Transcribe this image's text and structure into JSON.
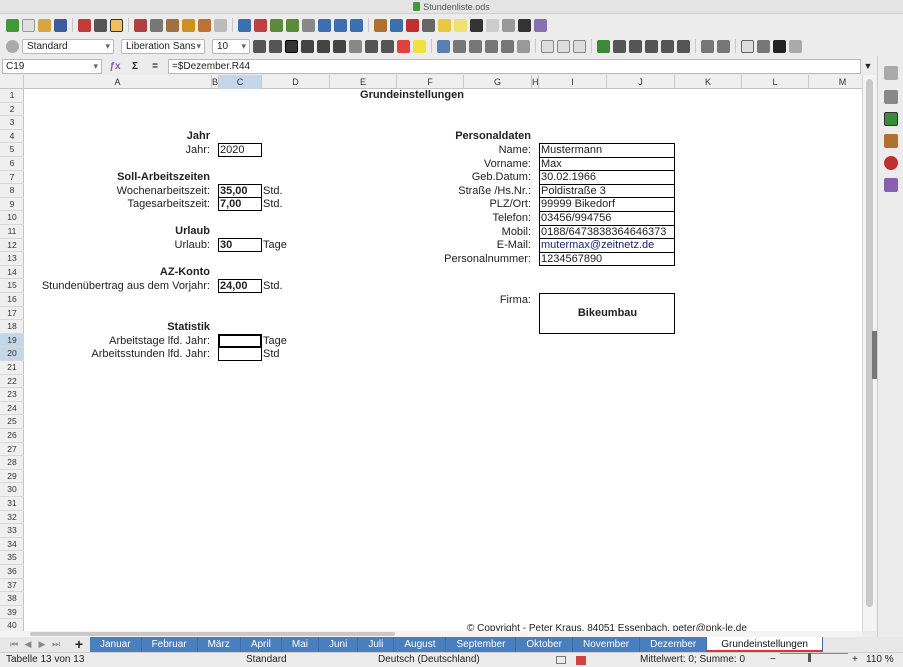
{
  "window": {
    "title": "Stundenliste.ods"
  },
  "toolbar": {
    "paragraph_style": "Standard",
    "font_name": "Liberation Sans",
    "font_size": "10"
  },
  "formula_bar": {
    "name_box": "C19",
    "formula": "=$Dezember.R44"
  },
  "columns": [
    "A",
    "B",
    "C",
    "D",
    "E",
    "F",
    "G",
    "H",
    "I",
    "J",
    "K",
    "L",
    "M"
  ],
  "rows": [
    "1",
    "2",
    "3",
    "4",
    "5",
    "6",
    "7",
    "8",
    "9",
    "10",
    "11",
    "12",
    "13",
    "14",
    "15",
    "16",
    "17",
    "18",
    "19",
    "20",
    "21",
    "22",
    "23",
    "24",
    "25",
    "26",
    "27",
    "28",
    "29",
    "30",
    "31",
    "32",
    "33",
    "34",
    "35",
    "36",
    "37",
    "38",
    "39",
    "40"
  ],
  "sheet": {
    "title": "Grundeinstellungen",
    "jahr": {
      "heading": "Jahr",
      "label": "Jahr:",
      "value": "2020"
    },
    "soll": {
      "heading": "Soll-Arbeitszeiten",
      "woche_label": "Wochenarbeitszeit:",
      "woche_value": "35,00",
      "woche_unit": "Std.",
      "tag_label": "Tagesarbeitszeit:",
      "tag_value": "7,00",
      "tag_unit": "Std."
    },
    "urlaub": {
      "heading": "Urlaub",
      "label": "Urlaub:",
      "value": "30",
      "unit": "Tage"
    },
    "az": {
      "heading": "AZ-Konto",
      "label": "Stundenübertrag aus dem Vorjahr:",
      "value": "24,00",
      "unit": "Std."
    },
    "statistik": {
      "heading": "Statistik",
      "tage_label": "Arbeitstage lfd. Jahr:",
      "tage_value": "",
      "tage_unit": "Tage",
      "stunden_label": "Arbeitsstunden lfd. Jahr:",
      "stunden_value": "",
      "stunden_unit": "Std"
    },
    "personal": {
      "heading": "Personaldaten",
      "fields": [
        {
          "label": "Name:",
          "value": "Mustermann"
        },
        {
          "label": "Vorname:",
          "value": "Max"
        },
        {
          "label": "Geb.Datum:",
          "value": "30.02.1966"
        },
        {
          "label": "Straße /Hs.Nr.:",
          "value": "Poldistraße 3"
        },
        {
          "label": "PLZ/Ort:",
          "value": "99999 Bikedorf"
        },
        {
          "label": "Telefon:",
          "value": "03456/994756"
        },
        {
          "label": "Mobil:",
          "value": "0188/6473838364646373"
        },
        {
          "label": "E-Mail:",
          "value": "mutermax@zeitnetz.de"
        },
        {
          "label": "Personalnummer:",
          "value": "1234567890"
        }
      ]
    },
    "firma": {
      "label": "Firma:",
      "value": "Bikeumbau"
    },
    "copyright": "© Copyright - Peter Kraus, 84051 Essenbach, peter@pnk-le.de"
  },
  "sheet_tabs": [
    "Januar",
    "Februar",
    "März",
    "April",
    "Mai",
    "Juni",
    "Juli",
    "August",
    "September",
    "Oktober",
    "November",
    "Dezember",
    "Grundeinstellungen"
  ],
  "active_tab": "Grundeinstellungen",
  "status": {
    "sheet_pos": "Tabelle 13 von 13",
    "page_style": "Standard",
    "language": "Deutsch (Deutschland)",
    "summary": "Mittelwert: 0; Summe: 0",
    "zoom": "110 %"
  }
}
